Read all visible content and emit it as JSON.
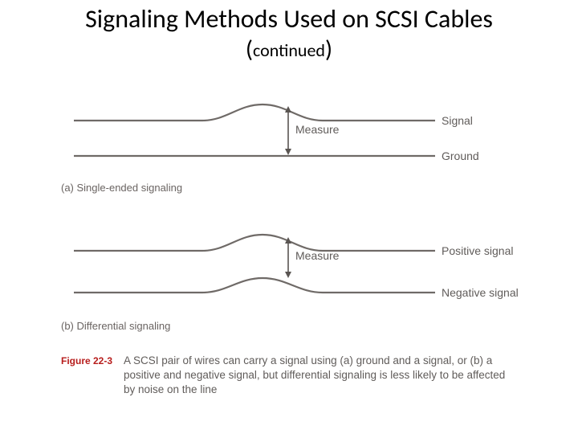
{
  "title": {
    "line1": "Signaling Methods Used on SCSI Cables",
    "line2_open": "(",
    "line2_word": "continued",
    "line2_close": ")"
  },
  "diagram_a": {
    "label_signal": "Signal",
    "label_ground": "Ground",
    "measure": "Measure",
    "caption": "(a) Single-ended signaling"
  },
  "diagram_b": {
    "label_positive": "Positive signal",
    "label_negative": "Negative signal",
    "measure": "Measure",
    "caption": "(b) Differential signaling"
  },
  "figure": {
    "id": "Figure 22-3",
    "caption": "A SCSI pair of wires can carry a signal using (a) ground and a signal, or (b) a positive and negative signal, but differential signaling is less likely to be affected by noise on the line"
  }
}
